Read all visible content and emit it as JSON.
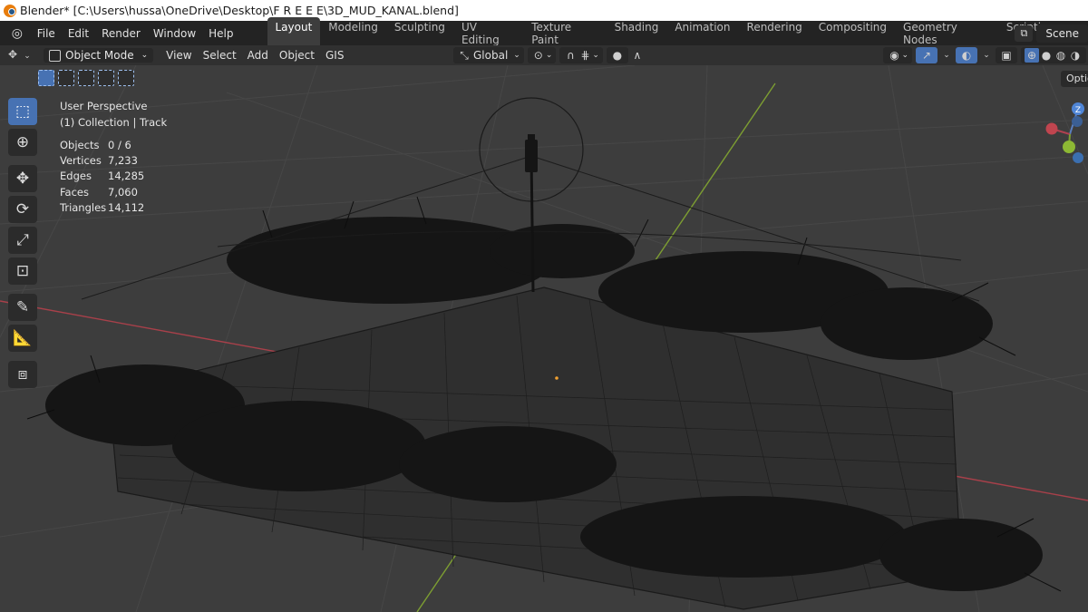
{
  "window": {
    "title": "Blender* [C:\\Users\\hussa\\OneDrive\\Desktop\\F R E E E\\3D_MUD_KANAL.blend]"
  },
  "menubar": {
    "items": [
      "File",
      "Edit",
      "Render",
      "Window",
      "Help"
    ],
    "tabs": [
      "Layout",
      "Modeling",
      "Sculpting",
      "UV Editing",
      "Texture Paint",
      "Shading",
      "Animation",
      "Rendering",
      "Compositing",
      "Geometry Nodes",
      "Scripting"
    ],
    "active_tab": "Layout",
    "add_tab": "+",
    "scene": "Scene"
  },
  "header": {
    "mode": "Object Mode",
    "menus": [
      "View",
      "Select",
      "Add",
      "Object",
      "GIS"
    ],
    "orientation": "Global",
    "options_label": "Optio"
  },
  "viewport": {
    "view_name": "User Perspective",
    "collection": "(1) Collection | Track",
    "stats": [
      {
        "label": "Objects",
        "value": "0 / 6"
      },
      {
        "label": "Vertices",
        "value": "7,233"
      },
      {
        "label": "Edges",
        "value": "14,285"
      },
      {
        "label": "Faces",
        "value": "7,060"
      },
      {
        "label": "Triangles",
        "value": "14,112"
      }
    ],
    "gizmo_z": "Z"
  },
  "colors": {
    "x_axis": "#c0454f",
    "y_axis": "#8db834",
    "active_blue": "#4772b3",
    "background": "#3d3d3d"
  },
  "tools": [
    "select-box-icon",
    "cursor-icon",
    "move-icon",
    "rotate-icon",
    "scale-icon",
    "transform-icon",
    "annotate-icon",
    "measure-icon",
    "add-cube-icon"
  ]
}
